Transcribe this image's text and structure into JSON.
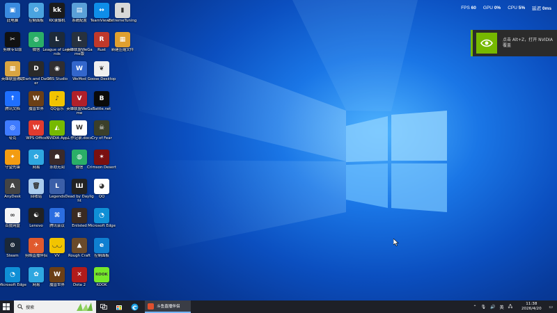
{
  "overlay": {
    "fps_label": "FPS",
    "fps_value": "60",
    "gpu_label": "GPU",
    "gpu_value": "0%",
    "cpu_label": "CPU",
    "cpu_value": "5%",
    "latency_label": "延迟",
    "latency_value": "0ms"
  },
  "toast": {
    "text": "点击 Alt+Z，打开 NVIDIA 覆盖"
  },
  "desktop_icons": [
    {
      "label": "此电脑",
      "color": "#3a8be0",
      "glyph": "▣"
    },
    {
      "label": "控制面板",
      "color": "#4aa3df",
      "glyph": "⚙"
    },
    {
      "label": "KK录像机",
      "color": "#1b1b1b",
      "glyph": "kk"
    },
    {
      "label": "系统配置",
      "color": "#5aa0d8",
      "glyph": "▤"
    },
    {
      "label": "TeamViewer",
      "color": "#0e8ee9",
      "glyph": "↔"
    },
    {
      "label": "ExtremeTuning",
      "color": "#d8d8d8",
      "glyph": "▮"
    },
    {
      "label": "剪映专业版",
      "color": "#111",
      "glyph": "✂"
    },
    {
      "label": "微信",
      "color": "#2aae67",
      "glyph": "◍"
    },
    {
      "label": "League of Legends",
      "color": "#1d2a3a",
      "glyph": "L"
    },
    {
      "label": "英雄联盟WeGame版",
      "color": "#27313f",
      "glyph": "L"
    },
    {
      "label": "Rust",
      "color": "#c0392b",
      "glyph": "R"
    },
    {
      "label": "新建压缩文件",
      "color": "#e0a030",
      "glyph": "▦"
    },
    {
      "label": "英雄联盟辅助",
      "color": "#d9a441",
      "glyph": "▦"
    },
    {
      "label": "Dark and Darker",
      "color": "#2a2a2a",
      "glyph": "D"
    },
    {
      "label": "OBS Studio",
      "color": "#302e31",
      "glyph": "◉"
    },
    {
      "label": "WeMod",
      "color": "#3366cc",
      "glyph": "W"
    },
    {
      "label": "Goose Desktop",
      "color": "#eeeeee",
      "glyph": "❦"
    },
    {
      "label": "腾讯文档",
      "color": "#1e6fff",
      "glyph": "↑"
    },
    {
      "label": "魔兽世界",
      "color": "#6b3f16",
      "glyph": "W"
    },
    {
      "label": "QQ音乐",
      "color": "#f2c300",
      "glyph": "♪"
    },
    {
      "label": "英雄联盟WeGame",
      "color": "#b0202a",
      "glyph": "V"
    },
    {
      "label": "Battle.net",
      "color": "#0a0a0a",
      "glyph": "B"
    },
    {
      "label": "夸克",
      "color": "#3f7bff",
      "glyph": "◎"
    },
    {
      "label": "WPS Office",
      "color": "#e23b2e",
      "glyph": "W"
    },
    {
      "label": "NVIDIA App",
      "color": "#76b900",
      "glyph": "◭"
    },
    {
      "label": "工作记录.docx",
      "color": "#ffffff",
      "glyph": "W"
    },
    {
      "label": "Cry of Fear",
      "color": "#3b3f2a",
      "glyph": "☠"
    },
    {
      "label": "守望先锋",
      "color": "#f39c12",
      "glyph": "✦"
    },
    {
      "label": "网易",
      "color": "#2ea7e0",
      "glyph": "✿"
    },
    {
      "label": "永劫无间",
      "color": "#3a2a2a",
      "glyph": "☗"
    },
    {
      "label": "微信",
      "color": "#2aae67",
      "glyph": "◍"
    },
    {
      "label": "Crimson Desert",
      "color": "#7a1010",
      "glyph": "✶"
    },
    {
      "label": "AnyDesk",
      "color": "#444",
      "glyph": "A"
    },
    {
      "label": "回收站",
      "color": "#aaccee",
      "glyph": "🗑"
    },
    {
      "label": "Legends",
      "color": "#3b5fa8",
      "glyph": "L"
    },
    {
      "label": "Dead by Daylight",
      "color": "#222",
      "glyph": "Ш"
    },
    {
      "label": "QQ",
      "color": "#ffffff",
      "glyph": "◕"
    },
    {
      "label": "百度网盘",
      "color": "#f5f5f5",
      "glyph": "∞"
    },
    {
      "label": "Lenovo",
      "color": "#222",
      "glyph": "☯"
    },
    {
      "label": "腾讯会议",
      "color": "#2b6de0",
      "glyph": "⌘"
    },
    {
      "label": "Enlisted",
      "color": "#3a2a22",
      "glyph": "E"
    },
    {
      "label": "Microsoft Edge",
      "color": "#0f8fd6",
      "glyph": "◔"
    },
    {
      "label": "Steam",
      "color": "#1b2838",
      "glyph": "⊙"
    },
    {
      "label": "剪映直播伴侣",
      "color": "#e05a2e",
      "glyph": "✈"
    },
    {
      "label": "VV",
      "color": "#f2c400",
      "glyph": "◡◡"
    },
    {
      "label": "Rough Craft",
      "color": "#6a4a2a",
      "glyph": "▲"
    },
    {
      "label": "控制面板",
      "color": "#0f7fd1",
      "glyph": "e"
    },
    {
      "label": "Microsoft Edge",
      "color": "#0f8fd6",
      "glyph": "◔"
    },
    {
      "label": "网易",
      "color": "#2ea7e0",
      "glyph": "✿"
    },
    {
      "label": "魔兽世界",
      "color": "#6b3f16",
      "glyph": "W"
    },
    {
      "label": "Dota 2",
      "color": "#b11b1b",
      "glyph": "✕"
    },
    {
      "label": "KOOK",
      "color": "#75e82a",
      "glyph": "KOOK"
    }
  ],
  "taskbar": {
    "search_placeholder": "搜索",
    "app_label": "斗鱼直播伴侣",
    "tray_lang": "英",
    "time": "11:38",
    "date": "2026/4/20"
  }
}
